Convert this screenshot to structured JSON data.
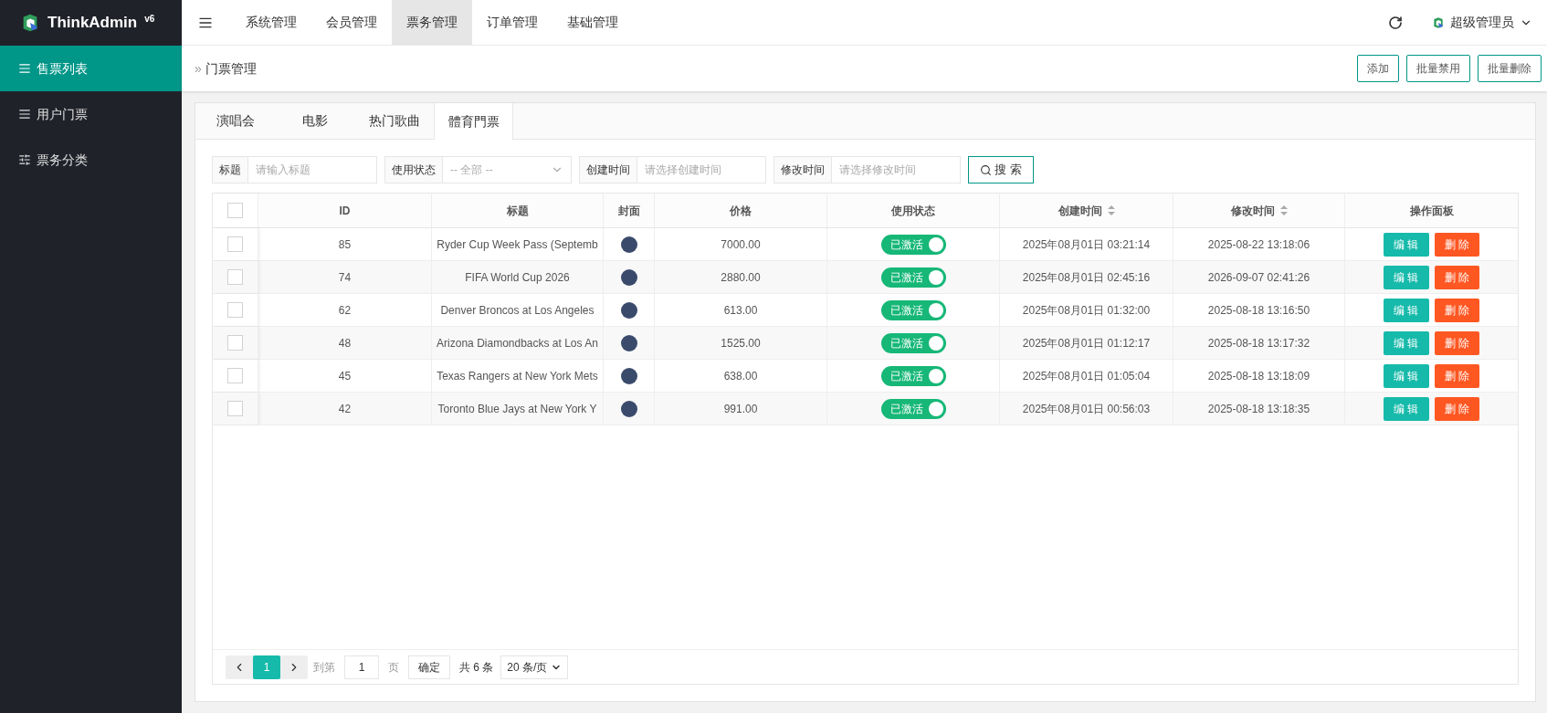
{
  "brand": {
    "name": "ThinkAdmin",
    "version": "v6"
  },
  "sidebar": {
    "items": [
      {
        "label": "售票列表",
        "selected": true,
        "kind": "list"
      },
      {
        "label": "用户门票",
        "selected": false,
        "kind": "list"
      },
      {
        "label": "票务分类",
        "selected": false,
        "kind": "sliders"
      }
    ]
  },
  "top_nav": {
    "items": [
      {
        "label": "系统管理",
        "selected": false
      },
      {
        "label": "会员管理",
        "selected": false
      },
      {
        "label": "票务管理",
        "selected": true
      },
      {
        "label": "订单管理",
        "selected": false
      },
      {
        "label": "基础管理",
        "selected": false
      }
    ],
    "user": "超级管理员"
  },
  "breadcrumb": {
    "icon": "»",
    "label": "门票管理"
  },
  "actions": [
    "添加",
    "批量禁用",
    "批量删除"
  ],
  "tabs": [
    {
      "label": "演唱会",
      "selected": false
    },
    {
      "label": "电影",
      "selected": false
    },
    {
      "label": "热门歌曲",
      "selected": false
    },
    {
      "label": "體育門票",
      "selected": true
    }
  ],
  "filters": [
    {
      "label": "标题",
      "kind": "text",
      "placeholder": "请输入标题"
    },
    {
      "label": "使用状态",
      "kind": "select",
      "placeholder": "-- 全部 --"
    },
    {
      "label": "创建时间",
      "kind": "text",
      "placeholder": "请选择创建时间"
    },
    {
      "label": "修改时间",
      "kind": "text",
      "placeholder": "请选择修改时间"
    }
  ],
  "search_button": "搜 索",
  "table": {
    "all_checked": false,
    "columns": [
      {
        "label": "ID",
        "sortable": false
      },
      {
        "label": "标题",
        "sortable": false
      },
      {
        "label": "封面",
        "sortable": false
      },
      {
        "label": "价格",
        "sortable": false
      },
      {
        "label": "使用状态",
        "sortable": false
      },
      {
        "label": "创建时间",
        "sortable": true
      },
      {
        "label": "修改时间",
        "sortable": true
      },
      {
        "label": "操作面板",
        "sortable": false
      }
    ],
    "rows": [
      {
        "checked": false,
        "id": "85",
        "title": "Ryder Cup Week Pass (Septemb",
        "price": "7000.00",
        "status": "已激活",
        "on": true,
        "created": "2025年08月01日 03:21:14",
        "modified": "2025-08-22 13:18:06",
        "actions": [
          "编 辑",
          "删 除"
        ]
      },
      {
        "checked": false,
        "id": "74",
        "title": "FIFA World Cup 2026",
        "price": "2880.00",
        "status": "已激活",
        "on": true,
        "created": "2025年08月01日 02:45:16",
        "modified": "2026-09-07 02:41:26",
        "actions": [
          "编 辑",
          "删 除"
        ]
      },
      {
        "checked": false,
        "id": "62",
        "title": "Denver Broncos at Los Angeles",
        "price": "613.00",
        "status": "已激活",
        "on": true,
        "created": "2025年08月01日 01:32:00",
        "modified": "2025-08-18 13:16:50",
        "actions": [
          "编 辑",
          "删 除"
        ]
      },
      {
        "checked": false,
        "id": "48",
        "title": "Arizona Diamondbacks at Los An",
        "price": "1525.00",
        "status": "已激活",
        "on": true,
        "created": "2025年08月01日 01:12:17",
        "modified": "2025-08-18 13:17:32",
        "actions": [
          "编 辑",
          "删 除"
        ]
      },
      {
        "checked": false,
        "id": "45",
        "title": "Texas Rangers at New York Mets",
        "price": "638.00",
        "status": "已激活",
        "on": true,
        "created": "2025年08月01日 01:05:04",
        "modified": "2025-08-18 13:18:09",
        "actions": [
          "编 辑",
          "删 除"
        ]
      },
      {
        "checked": false,
        "id": "42",
        "title": "Toronto Blue Jays at New York Y",
        "price": "991.00",
        "status": "已激活",
        "on": true,
        "created": "2025年08月01日 00:56:03",
        "modified": "2025-08-18 13:18:35",
        "actions": [
          "编 辑",
          "删 除"
        ]
      }
    ]
  },
  "pagination": {
    "pages": [
      {
        "label": "1",
        "selected": true
      }
    ],
    "goto_label": "到第",
    "goto_value": "1",
    "page_unit": "页",
    "confirm": "确定",
    "total": "共 6 条",
    "page_size": "20 条/页"
  }
}
